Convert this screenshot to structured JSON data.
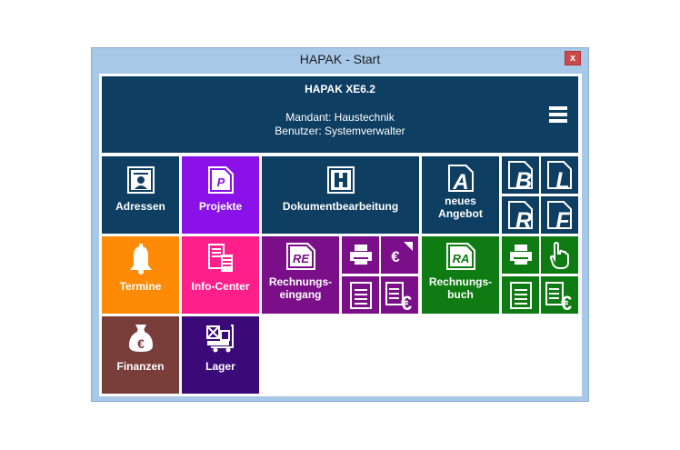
{
  "window": {
    "title": "HAPAK - Start",
    "close_glyph": "x"
  },
  "header": {
    "title": "HAPAK XE6.2",
    "mandant": "Mandant: Haustechnik",
    "benutzer": "Benutzer: Systemverwalter",
    "menu_icon": "hamburger-menu-icon"
  },
  "tiles": {
    "adressen": {
      "label": "Adressen",
      "color": "#0f3e63",
      "icon": "address-card-icon"
    },
    "projekte": {
      "label": "Projekte",
      "color": "#8a11e8",
      "icon": "project-document-icon",
      "glyph": "P"
    },
    "dokument": {
      "label": "Dokumentbearbeitung",
      "color": "#0f3e63",
      "icon": "document-h-icon",
      "glyph": "H"
    },
    "angebot": {
      "label1": "neues",
      "label2": "Angebot",
      "color": "#0f3e63",
      "icon": "offer-document-icon",
      "glyph": "A"
    },
    "doc_b": {
      "glyph": "B",
      "icon": "document-b-icon"
    },
    "doc_l": {
      "glyph": "L",
      "icon": "document-l-icon"
    },
    "doc_r": {
      "glyph": "R",
      "icon": "document-r-icon"
    },
    "doc_f": {
      "glyph": "F",
      "icon": "document-f-icon"
    },
    "termine": {
      "label": "Termine",
      "color": "#ff8a05",
      "icon": "bell-icon"
    },
    "info": {
      "label": "Info-Center",
      "color": "#ff1f8a",
      "icon": "info-center-icon"
    },
    "re": {
      "label1": "Rechnungs-",
      "label2": "eingang",
      "color": "#7b0f8a",
      "icon": "incoming-invoice-icon",
      "glyph": "RE",
      "euro": "€"
    },
    "ra": {
      "label1": "Rechnungs-",
      "label2": "buch",
      "color": "#0e7c12",
      "icon": "invoice-book-icon",
      "glyph": "RA",
      "euro": "€"
    },
    "finanzen": {
      "label": "Finanzen",
      "color": "#7a3e3a",
      "icon": "money-bag-icon",
      "euro": "€"
    },
    "lager": {
      "label": "Lager",
      "color": "#3c0a78",
      "icon": "hand-truck-icon"
    }
  }
}
